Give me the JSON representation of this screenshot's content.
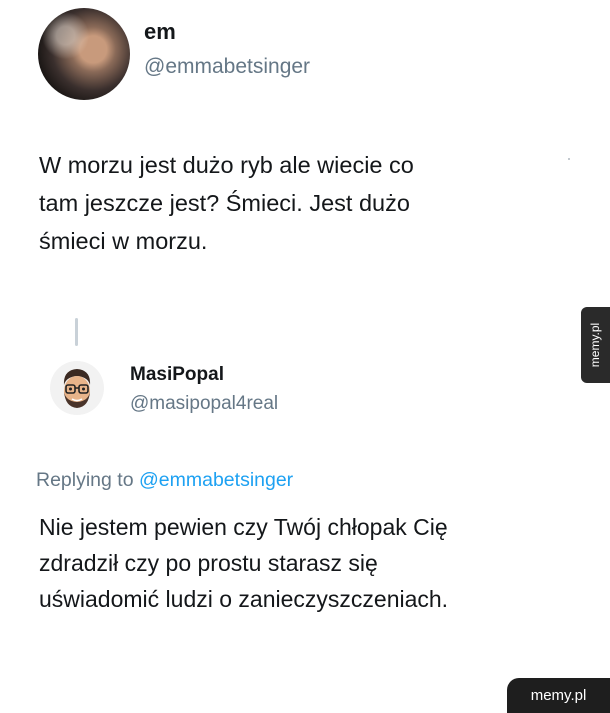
{
  "tweet": {
    "name": "em",
    "handle": "@emmabetsinger",
    "text_lines": [
      "W morzu jest dużo ryb ale wiecie co",
      "tam jeszcze jest? Śmieci. Jest dużo",
      "śmieci w morzu."
    ]
  },
  "reply": {
    "name": "MasiPopal",
    "handle": "@masipopal4real",
    "replying_prefix": "Replying to",
    "replying_handle": "@emmabetsinger",
    "text_lines": [
      "Nie jestem pewien czy Twój chłopak Cię",
      "zdradził czy po prostu starasz się",
      "uświadomić ludzi o zanieczyszczeniach."
    ]
  },
  "watermark": {
    "side": "memy.pl",
    "bottom": "memy.pl"
  },
  "icons": {
    "avatar_em": "profile-photo",
    "avatar_masi": "memoji-face"
  }
}
